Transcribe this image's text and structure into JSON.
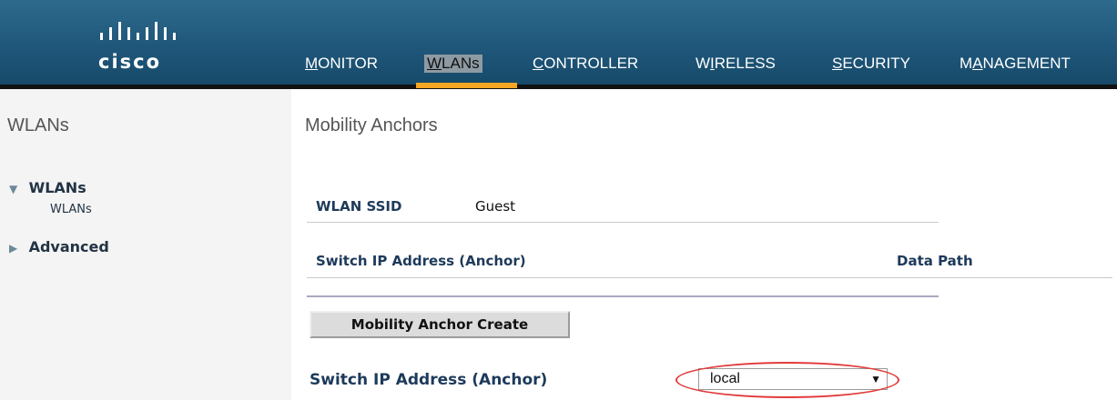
{
  "brand": {
    "name": "cisco"
  },
  "nav": [
    {
      "pre": "",
      "ul": "M",
      "post": "ONITOR"
    },
    {
      "pre": "",
      "ul": "W",
      "post": "LANs"
    },
    {
      "pre": "",
      "ul": "C",
      "post": "ONTROLLER"
    },
    {
      "pre": "W",
      "ul": "I",
      "post": "RELESS"
    },
    {
      "pre": "",
      "ul": "S",
      "post": "ECURITY"
    },
    {
      "pre": "M",
      "ul": "A",
      "post": "NAGEMENT"
    }
  ],
  "sidebar": {
    "title": "WLANs",
    "groups": [
      {
        "label": "WLANs",
        "icon": "triangle-down-icon"
      },
      {
        "label": "Advanced",
        "icon": "triangle-right-icon"
      }
    ],
    "sub_item": "WLANs"
  },
  "main": {
    "title": "Mobility Anchors",
    "ssid_label": "WLAN SSID",
    "ssid_value": "Guest",
    "col_anchor": "Switch IP Address (Anchor)",
    "col_datapath": "Data Path",
    "create_button": "Mobility Anchor Create",
    "anchor_label": "Switch IP Address (Anchor)",
    "anchor_value": "local"
  },
  "colors": {
    "banner": "#1f577a",
    "active_tab": "#f5a623",
    "highlight": "#e23b3b"
  }
}
